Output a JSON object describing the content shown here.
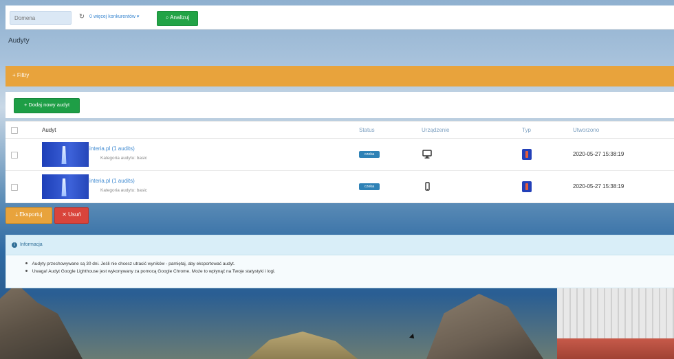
{
  "topbar": {
    "domain_placeholder": "Domena",
    "competitors_text": "0 więcej konkurentów ▾",
    "analyze_label": "Analizuj"
  },
  "page": {
    "title": "Audyty"
  },
  "filters": {
    "label": "+ Filtry"
  },
  "actions": {
    "add_label": "+ Dodaj nowy audyt"
  },
  "table": {
    "headers": {
      "audit": "Audyt",
      "status": "Status",
      "device": "Urządzenie",
      "type": "Typ",
      "created": "Utworzono"
    },
    "rows": [
      {
        "name": "interia.pl (1 audits)",
        "category": "Kategoria audytu: basic",
        "status": "czeka",
        "device_icon": "desktop-icon",
        "type_icon": "lighthouse-icon",
        "created": "2020-05-27 15:38:19"
      },
      {
        "name": "interia.pl (1 audits)",
        "category": "Kategoria audytu: basic",
        "status": "czeka",
        "device_icon": "mobile-icon",
        "type_icon": "lighthouse-icon",
        "created": "2020-05-27 15:38:19"
      }
    ]
  },
  "bottom_actions": {
    "export_label": "Eksportuj",
    "delete_label": "Usuń"
  },
  "info": {
    "title": "Informacja",
    "lines": [
      "Audyty przechowywane są 30 dni. Jeśli nie chcesz utracić wyników - pamiętaj, aby eksportować audyt.",
      "Uwaga! Audyt Google Lighthouse jest wykonywany za pomocą Google Chrome. Może to wpłynąć na Twoje statystyki i logi."
    ]
  },
  "colors": {
    "orange": "#e8a33c",
    "green": "#22a346",
    "red": "#d9443b",
    "blue": "#3f8ad1",
    "info_blue": "#2f6e97"
  }
}
